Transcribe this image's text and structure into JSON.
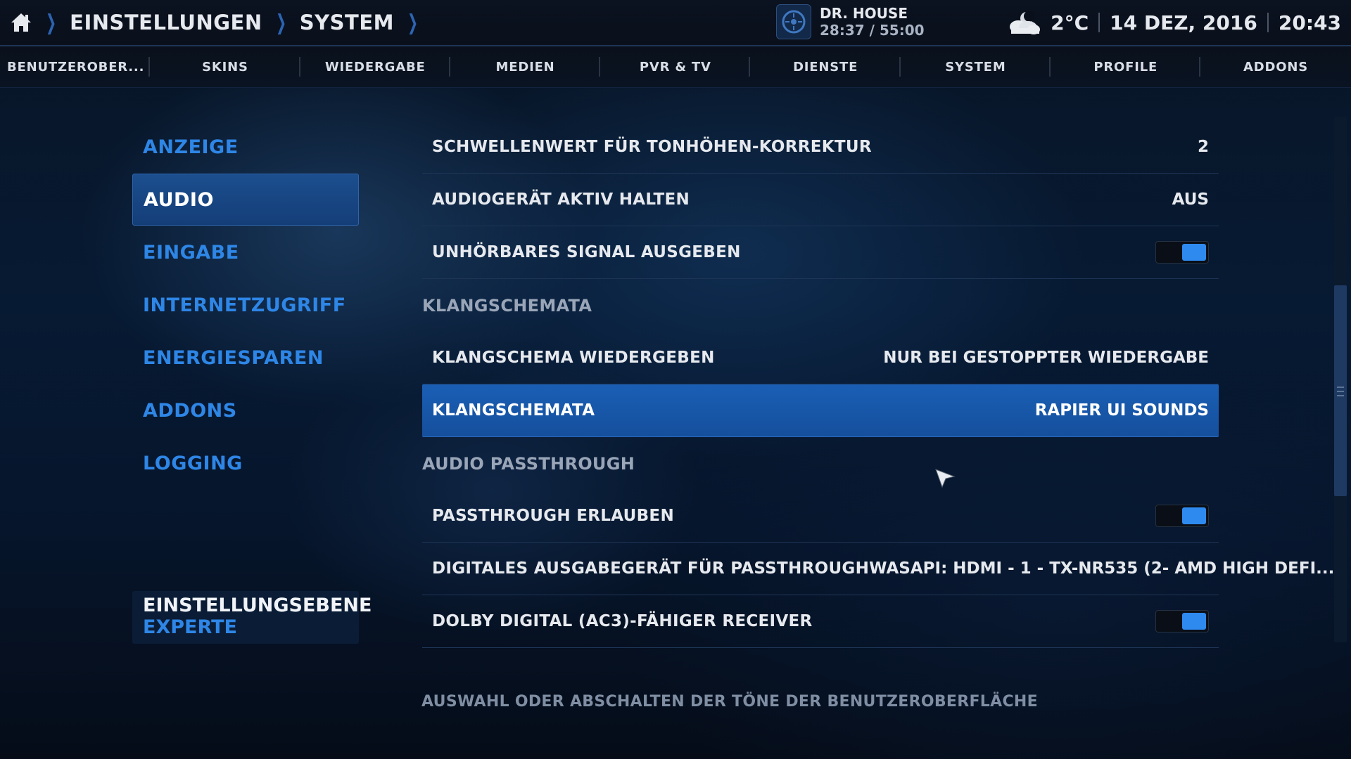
{
  "topbar": {
    "breadcrumb": [
      "EINSTELLUNGEN",
      "SYSTEM"
    ],
    "now_playing": {
      "title": "DR. HOUSE",
      "time": "28:37 / 55:00"
    },
    "weather": "2°C",
    "date": "14 DEZ, 2016",
    "clock": "20:43"
  },
  "tabs": [
    "BENUTZEROBER...",
    "SKINS",
    "WIEDERGABE",
    "MEDIEN",
    "PVR & TV",
    "DIENSTE",
    "SYSTEM",
    "PROFILE",
    "ADDONS"
  ],
  "sidebar": {
    "items": [
      "ANZEIGE",
      "AUDIO",
      "EINGABE",
      "INTERNETZUGRIFF",
      "ENERGIESPAREN",
      "ADDONS",
      "LOGGING"
    ],
    "active": "AUDIO",
    "level_title": "EINSTELLUNGSEBENE",
    "level_value": "EXPERTE"
  },
  "settings": {
    "row1": {
      "label": "SCHWELLENWERT FÜR TONHÖHEN-KORREKTUR",
      "value": "2"
    },
    "row2": {
      "label": "AUDIOGERÄT AKTIV HALTEN",
      "value": "AUS"
    },
    "row3": {
      "label": "UNHÖRBARES SIGNAL AUSGEBEN",
      "toggle": true
    },
    "header1": "KLANGSCHEMATA",
    "row4": {
      "label": "KLANGSCHEMA WIEDERGEBEN",
      "value": "NUR BEI GESTOPPTER WIEDERGABE"
    },
    "row5": {
      "label": "KLANGSCHEMATA",
      "value": "RAPIER UI SOUNDS"
    },
    "header2": "AUDIO PASSTHROUGH",
    "row6": {
      "label": "PASSTHROUGH ERLAUBEN",
      "toggle": true
    },
    "row7": {
      "label": "DIGITALES AUSGABEGERÄT FÜR PASSTHROUGH",
      "value": "WASAPI: HDMI - 1 - TX-NR535 (2- AMD HIGH DEFI..."
    },
    "row8": {
      "label": "DOLBY DIGITAL (AC3)-FÄHIGER RECEIVER",
      "toggle": true
    }
  },
  "description": "AUSWAHL ODER ABSCHALTEN DER TÖNE DER BENUTZEROBERFLÄCHE",
  "colors": {
    "accent": "#2e86e6",
    "selected": "#1a5fb5",
    "toggle_on": "#2f8af0"
  },
  "icons": {
    "home": "home-icon",
    "weather": "cloudy-night-icon",
    "now_playing": "disc-icon",
    "cursor": "mouse-pointer-icon"
  }
}
